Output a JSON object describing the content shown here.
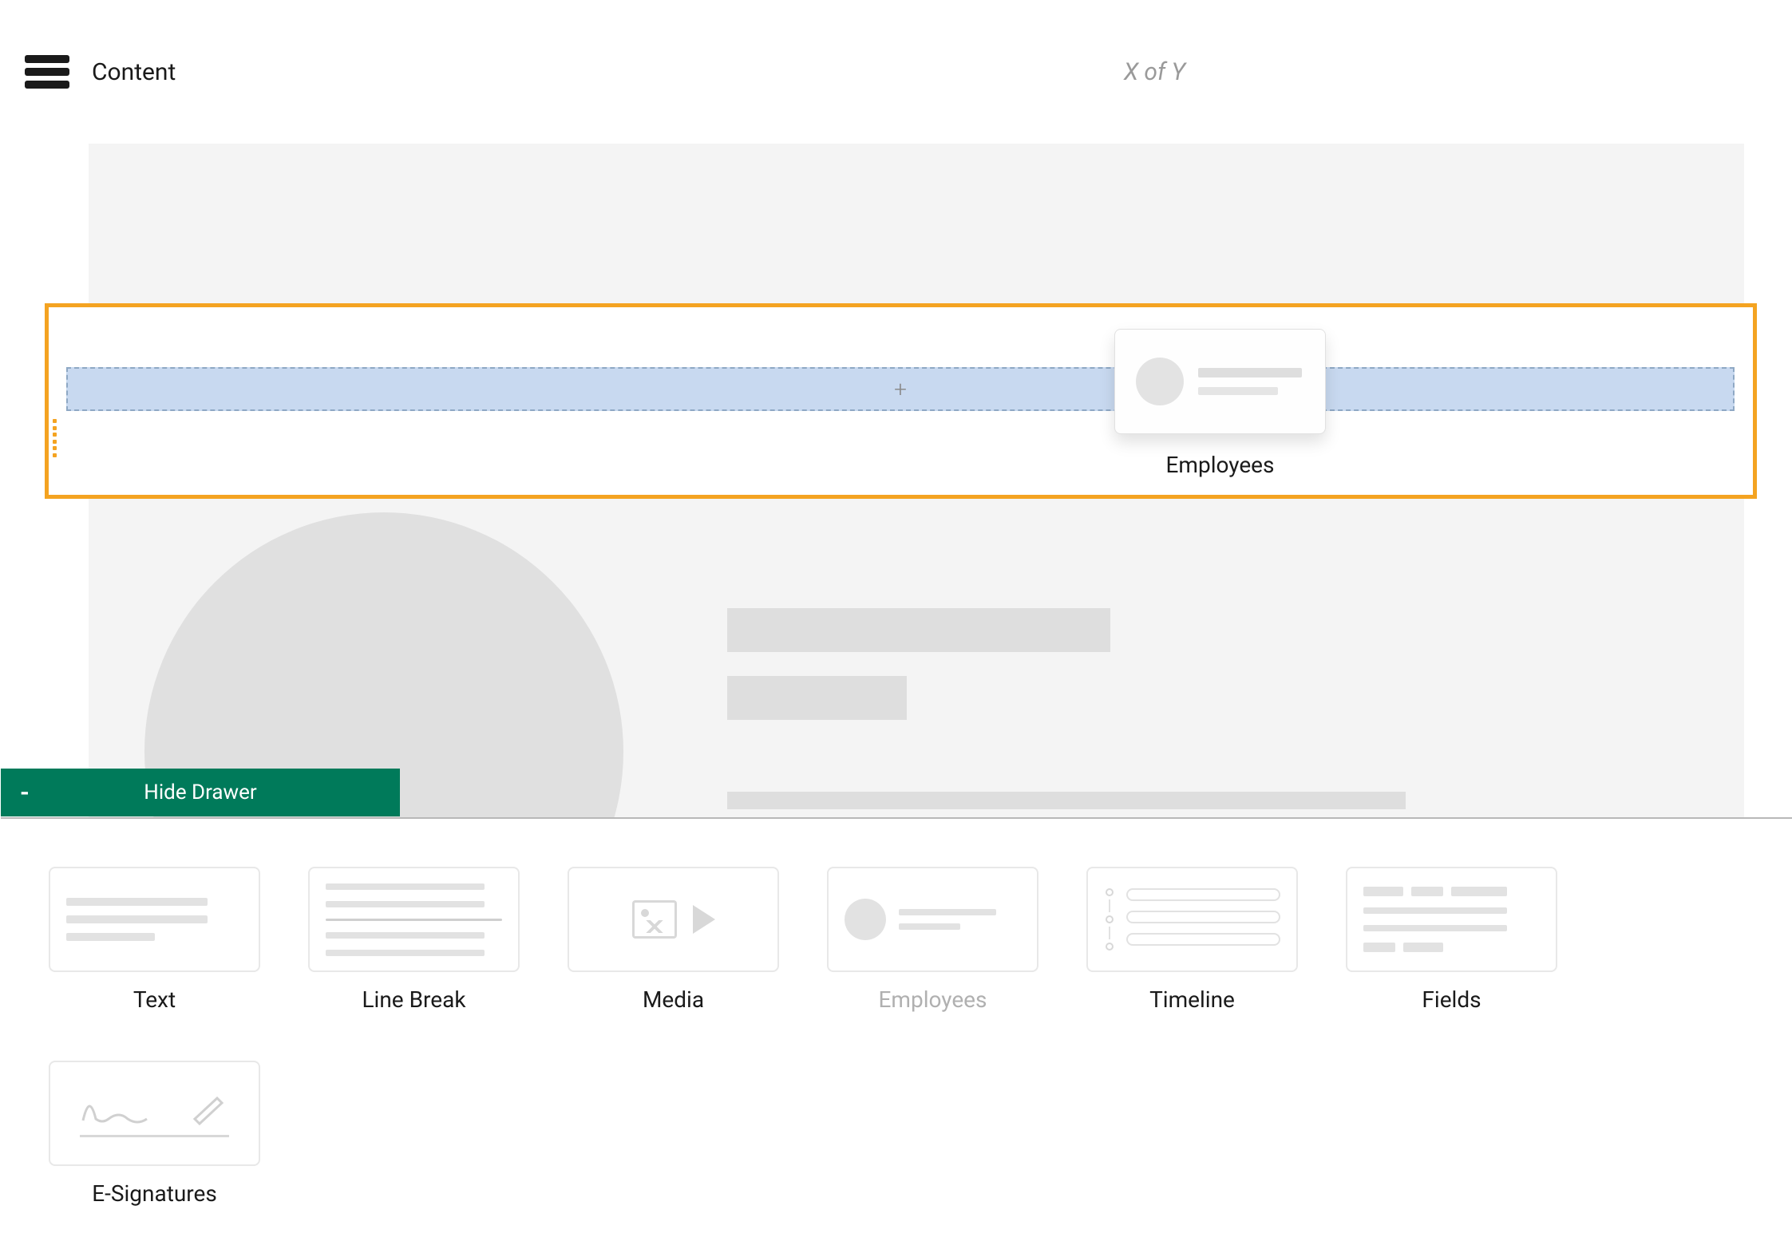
{
  "header": {
    "title": "Content",
    "pager": "X of Y"
  },
  "colors": {
    "accent_green": "#007a5a",
    "highlight_orange": "#f4a321",
    "dropzone_blue": "#c8d9f0"
  },
  "dropzone": {
    "plus": "+"
  },
  "drag_card": {
    "label": "Employees"
  },
  "hide_drawer": {
    "minus": "-",
    "label": "Hide Drawer"
  },
  "drawer": {
    "items": [
      {
        "label": "Text",
        "type": "text",
        "disabled": false
      },
      {
        "label": "Line Break",
        "type": "linebreak",
        "disabled": false
      },
      {
        "label": "Media",
        "type": "media",
        "disabled": false
      },
      {
        "label": "Employees",
        "type": "employees",
        "disabled": true
      },
      {
        "label": "Timeline",
        "type": "timeline",
        "disabled": false
      },
      {
        "label": "Fields",
        "type": "fields",
        "disabled": false
      },
      {
        "label": "E-Signatures",
        "type": "esign",
        "disabled": false
      }
    ]
  }
}
